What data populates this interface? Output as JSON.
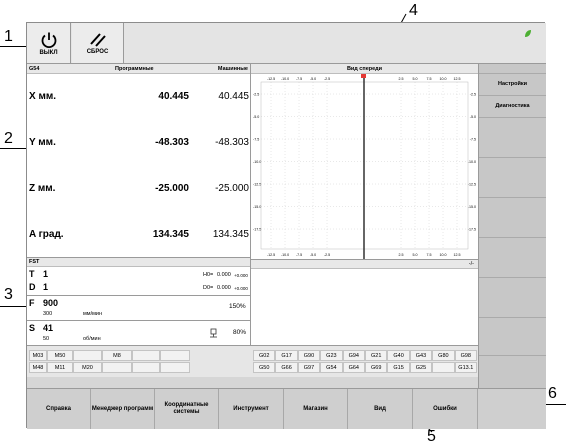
{
  "callouts": [
    "1",
    "2",
    "3",
    "4",
    "5",
    "6"
  ],
  "toolbar": {
    "power": {
      "label": "ВЫКЛ",
      "icon": "power-icon"
    },
    "reset": {
      "label": "СБРОС",
      "icon": "reset-slash-icon"
    },
    "status_icon": "leaf-icon"
  },
  "coords": {
    "cs": "G54",
    "col_prog": "Программные",
    "col_mach": "Машинные",
    "axes": [
      {
        "name": "X мм.",
        "prog": "40.445",
        "mach": "40.445"
      },
      {
        "name": "Y мм.",
        "prog": "-48.303",
        "mach": "-48.303"
      },
      {
        "name": "Z мм.",
        "prog": "-25.000",
        "mach": "-25.000"
      },
      {
        "name": "A град.",
        "prog": "134.345",
        "mach": "134.345"
      }
    ]
  },
  "view": {
    "title": "Вид спереди",
    "xticks": [
      "-12.5",
      "-10.0",
      "-7.5",
      "-5.0",
      "-2.5",
      "2.5",
      "5.0",
      "7.5",
      "10.0",
      "12.5"
    ],
    "yticks": [
      "-2.5",
      "-5.0",
      "-7.5",
      "-10.0",
      "-12.5",
      "-15.0",
      "-17.5"
    ]
  },
  "sidebar": {
    "items": [
      "Настройки",
      "Диагностика"
    ]
  },
  "fst": {
    "title": "FST",
    "t": {
      "label": "T",
      "value": "1",
      "h_label": "H0=",
      "h_value": "0.000",
      "h_sub": "+0.000"
    },
    "d": {
      "label": "D",
      "value": "1",
      "d_label": "D0=",
      "d_value": "0.000",
      "d_sub": "+0.000"
    },
    "f": {
      "label": "F",
      "value": "900",
      "actual": "300",
      "unit": "мм/мин",
      "override": "150%"
    },
    "s": {
      "label": "S",
      "value": "41",
      "actual": "50",
      "unit": "об/мин",
      "override": "80%"
    }
  },
  "msg": {
    "indicator": "-/-"
  },
  "mcodes": {
    "row1": [
      "M03",
      "M50",
      "",
      "M8",
      "",
      ""
    ],
    "row2": [
      "M48",
      "M11",
      "M20",
      "",
      "",
      ""
    ]
  },
  "gcodes": {
    "row1": [
      "G02",
      "G17",
      "G90",
      "G23",
      "G94",
      "G21",
      "G40",
      "G43",
      "G80",
      "G98"
    ],
    "row2": [
      "G50",
      "G66",
      "G97",
      "G54",
      "G64",
      "G69",
      "G15",
      "G25",
      "",
      "G13.1"
    ]
  },
  "bottom": [
    "Справка",
    "Менеджер программ",
    "Координатные системы",
    "Инструмент",
    "Магазин",
    "Вид",
    "Ошибки",
    ""
  ]
}
